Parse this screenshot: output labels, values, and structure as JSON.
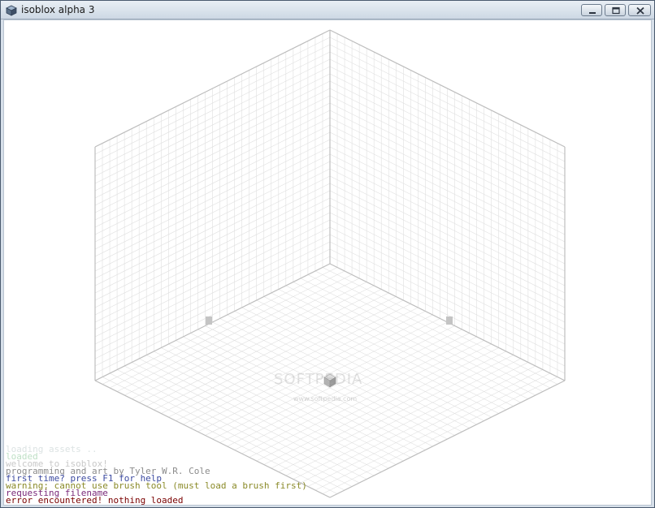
{
  "window": {
    "title": "isoblox alpha 3",
    "icon": "cube-icon"
  },
  "controls": {
    "minimize_icon": "minimize-icon",
    "maximize_icon": "maximize-icon",
    "close_icon": "close-icon"
  },
  "watermark": {
    "text": "SOFTPEDIA",
    "url": "www.softpedia.com"
  },
  "console": {
    "lines": [
      {
        "text": "loading assets ..",
        "color": "#dce3e3"
      },
      {
        "text": "loaded",
        "color": "#bfe0c6"
      },
      {
        "text": "welcome to isoblox!",
        "color": "#c9c9c9"
      },
      {
        "text": "programming and art by Tyler W.R. Cole",
        "color": "#8c8c8c"
      },
      {
        "text": "first time? press F1 for help",
        "color": "#3c4aa0"
      },
      {
        "text": "warning; cannot use brush tool (must load a brush first)",
        "color": "#8a8a28"
      },
      {
        "text": "requesting filename",
        "color": "#7a2a7a"
      },
      {
        "text": "error encountered! nothing loaded",
        "color": "#7a0000"
      }
    ]
  },
  "colors": {
    "grid_line": "#e0e0e0",
    "edge_line": "#bdbdbd",
    "canvas_bg": "#ffffff"
  }
}
